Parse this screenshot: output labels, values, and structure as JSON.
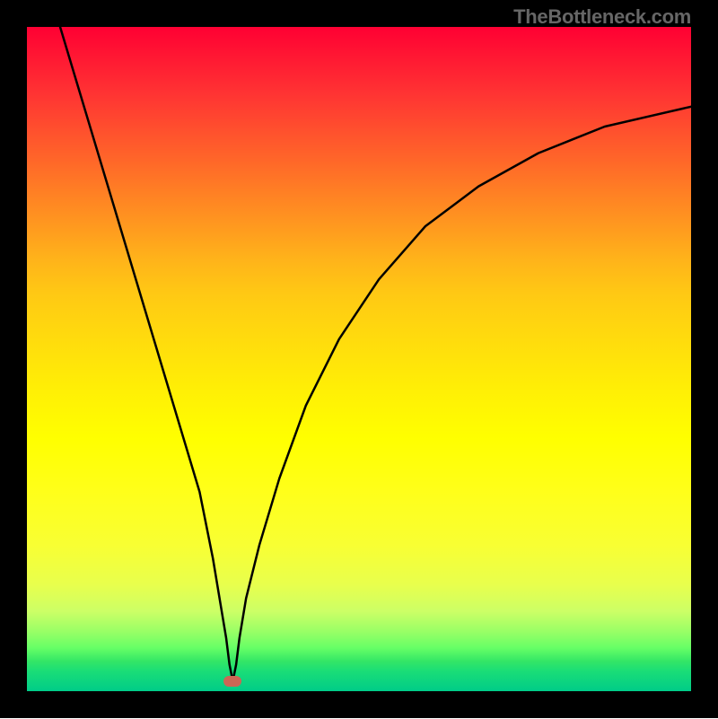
{
  "watermark": "TheBottleneck.com",
  "colors": {
    "frame": "#000000",
    "curve": "#000000",
    "marker": "#cc6655",
    "watermark": "#666666"
  },
  "chart_data": {
    "type": "line",
    "title": "",
    "xlabel": "",
    "ylabel": "",
    "xlim": [
      0,
      100
    ],
    "ylim": [
      0,
      100
    ],
    "grid": false,
    "legend": false,
    "minimum": {
      "x": 31,
      "y": 1.5
    },
    "series": [
      {
        "name": "bottleneck-curve",
        "x": [
          5,
          8,
          11,
          14,
          17,
          20,
          23,
          26,
          28,
          29,
          30,
          30.5,
          31,
          31.5,
          32,
          33,
          35,
          38,
          42,
          47,
          53,
          60,
          68,
          77,
          87,
          100
        ],
        "values": [
          100,
          90,
          80,
          70,
          60,
          50,
          40,
          30,
          20,
          14,
          8,
          4,
          1.5,
          4,
          8,
          14,
          22,
          32,
          43,
          53,
          62,
          70,
          76,
          81,
          85,
          88
        ]
      }
    ]
  }
}
